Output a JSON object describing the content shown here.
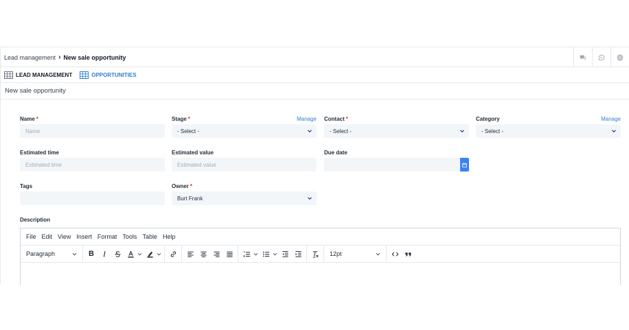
{
  "breadcrumb": {
    "parent": "Lead management",
    "current": "New sale opportunity"
  },
  "top_icons": [
    "chat-icon",
    "whatsapp-icon",
    "globe-icon"
  ],
  "tabs": [
    {
      "label": "LEAD MANAGEMENT",
      "active": false
    },
    {
      "label": "OPPORTUNITIES",
      "active": true
    }
  ],
  "page_title": "New sale opportunity",
  "form": {
    "name": {
      "label": "Name",
      "required": "*",
      "placeholder": "Name"
    },
    "stage": {
      "label": "Stage",
      "required": "*",
      "value": "- Select -",
      "manage": "Manage"
    },
    "contact": {
      "label": "Contact",
      "required": "*",
      "value": "- Select -"
    },
    "category": {
      "label": "Category",
      "value": "- Select -",
      "manage": "Manage"
    },
    "estimated_time": {
      "label": "Estimated time",
      "placeholder": "Estimated time"
    },
    "estimated_value": {
      "label": "Estimated value",
      "placeholder": "Estimated value"
    },
    "due_date": {
      "label": "Due date",
      "value": ""
    },
    "tags": {
      "label": "Tags",
      "value": ""
    },
    "owner": {
      "label": "Owner",
      "required": "*",
      "value": "Burt Frank"
    },
    "description": {
      "label": "Description"
    }
  },
  "editor": {
    "menu": [
      "File",
      "Edit",
      "View",
      "Insert",
      "Format",
      "Tools",
      "Table",
      "Help"
    ],
    "block_format": "Paragraph",
    "font_size": "12pt",
    "bold": "B",
    "italic": "I"
  },
  "colors": {
    "accent": "#2f7fd1",
    "required": "#dc2626",
    "input_bg": "#f3f6f9",
    "date_button": "#3b82f6"
  }
}
